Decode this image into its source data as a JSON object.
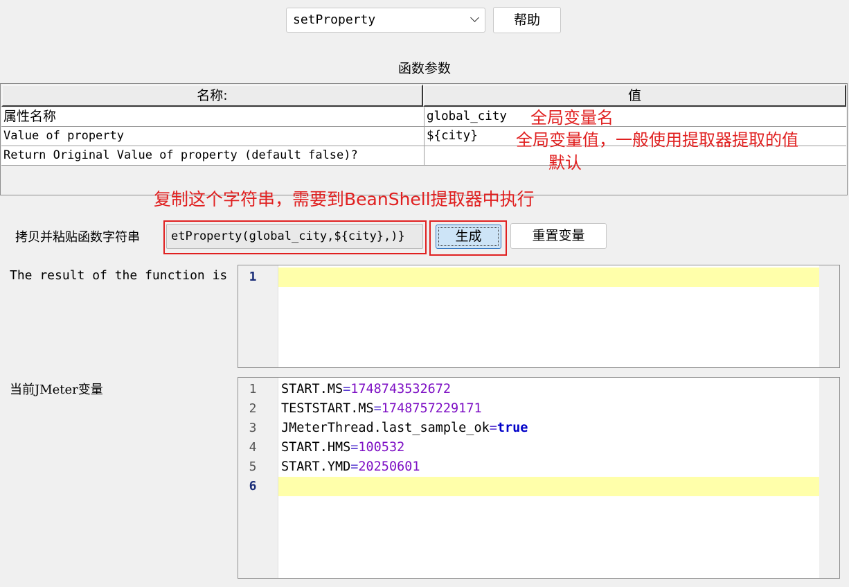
{
  "function_select": {
    "value": "setProperty"
  },
  "help_button": "帮助",
  "section_title": "函数参数",
  "params_table": {
    "headers": [
      "名称:",
      "值"
    ],
    "rows": [
      {
        "name": "属性名称",
        "value": "global_city"
      },
      {
        "name": "Value of property",
        "value": "${city}"
      },
      {
        "name": "Return Original Value of property (default false)?",
        "value": ""
      }
    ]
  },
  "annotations": {
    "var_name": "全局变量名",
    "var_value": "全局变量值，一般使用提取器提取的值",
    "default": "默认",
    "copy_hint": "复制这个字符串，需要到BeanShell提取器中执行"
  },
  "copy_label": "拷贝并粘贴函数字符串",
  "function_string": "etProperty(global_city,${city},)}",
  "generate_button": "生成",
  "reset_button": "重置变量",
  "result_label": "The result of the function is",
  "result_editor": {
    "line_numbers": [
      "1"
    ]
  },
  "vars_label": "当前JMeter变量",
  "vars_editor": {
    "line_numbers": [
      "1",
      "2",
      "3",
      "4",
      "5",
      "6"
    ],
    "lines": [
      {
        "key": "START.MS",
        "eq": "=",
        "value": "1748743532672"
      },
      {
        "key": "TESTSTART.MS",
        "eq": "=",
        "value": "1748757229171"
      },
      {
        "key": "JMeterThread.last_sample_ok",
        "eq": "=",
        "value": "true"
      },
      {
        "key": "START.HMS",
        "eq": "=",
        "value": "100532"
      },
      {
        "key": "START.YMD",
        "eq": "=",
        "value": "20250601"
      }
    ]
  },
  "colors": {
    "annotation_red": "#e02020",
    "current_line_highlight": "#ffffaa",
    "number_literal": "#7d0fc4",
    "boolean_literal": "#0000c8"
  }
}
